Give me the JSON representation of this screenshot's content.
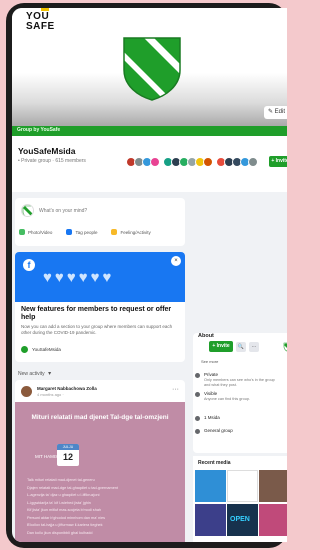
{
  "cover": {
    "brand_line1": "YOU",
    "brand_line2": "SAFE",
    "edit_label": "✎ Edit",
    "shield_colors": [
      "#1f9e2a",
      "#ffffff"
    ]
  },
  "green_bar": {
    "label": "Group by YouSafe"
  },
  "group": {
    "name": "YouSafeMsida",
    "meta": "• Private group · 615 members",
    "invite_label": "+ Invite",
    "avatar_colors": [
      "#c0392b",
      "#7f8c8d",
      "#3498db",
      "#e84393",
      "#16a085",
      "#2c3e50",
      "#27ae60",
      "#95a5a6",
      "#f1c40f",
      "#d35400",
      "#e74c3c",
      "#2c3e50",
      "#34495e",
      "#3498db",
      "#7f8c8d"
    ]
  },
  "composer": {
    "prompt": "What's on your mind?",
    "actions": [
      {
        "label": "Photo/Video",
        "color": "#45bd62"
      },
      {
        "label": "Tag people",
        "color": "#1877f2"
      },
      {
        "label": "Feeling/Activity",
        "color": "#f7b928"
      }
    ]
  },
  "feature_card": {
    "title": "New features for members to request or offer help",
    "body": "Now you can add a section to your group where members can support each other during the COVID-19 pandemic.",
    "group_label": "YouSafeMsida",
    "close": "×"
  },
  "feed": {
    "label": "New activity",
    "caret": "▾"
  },
  "post": {
    "author": "Margaret Nabbachowa Zolla",
    "time": "4 months ago · ",
    "poster_title": "Mituri relatati mad djenet Tal-dge tal-omzjeni",
    "poster_day": "MIT HAMIS",
    "cal_month": "JULJU",
    "cal_day": "12",
    "lines": [
      "Talk mituri relatati mad-djenet tal-generu",
      "Djajen relatati mad-dge tal-ghaqdiet u tad-gvernament",
      "L-agenzija ta' djaz u ghaqdiet u l-iffikruzjoni",
      "L-iggwidarija ta' kif l-wiehed jista' jghin",
      "Kif jista' jkun mitluf mas-socjeta b'modi shah",
      "Persuni aktar b'ghodod minnhom dan ma' nies",
      "B'kollox tal-hajja u jiffurmaw il-kariera tieghek",
      "Dan kollu jkun disponibbli ghal kulhadd"
    ]
  },
  "about": {
    "title": "About",
    "invite": "+ Invite",
    "search": "🔍",
    "more": "···",
    "see_more": "See more",
    "rows": [
      {
        "title": "Private",
        "sub": "Only members can see who's in the group and what they post."
      },
      {
        "title": "Visible",
        "sub": "Anyone can find this group."
      },
      {
        "title": "1 Msida",
        "sub": ""
      },
      {
        "title": "General group",
        "sub": ""
      }
    ]
  },
  "recent_media": {
    "title": "Recent media",
    "thumb_colors": [
      "#2f8fd6",
      "#ffffff",
      "#7a5a4a",
      "#3c3f8a",
      "#17324d",
      "#c04a7a"
    ],
    "neon_text": "OPEN"
  }
}
